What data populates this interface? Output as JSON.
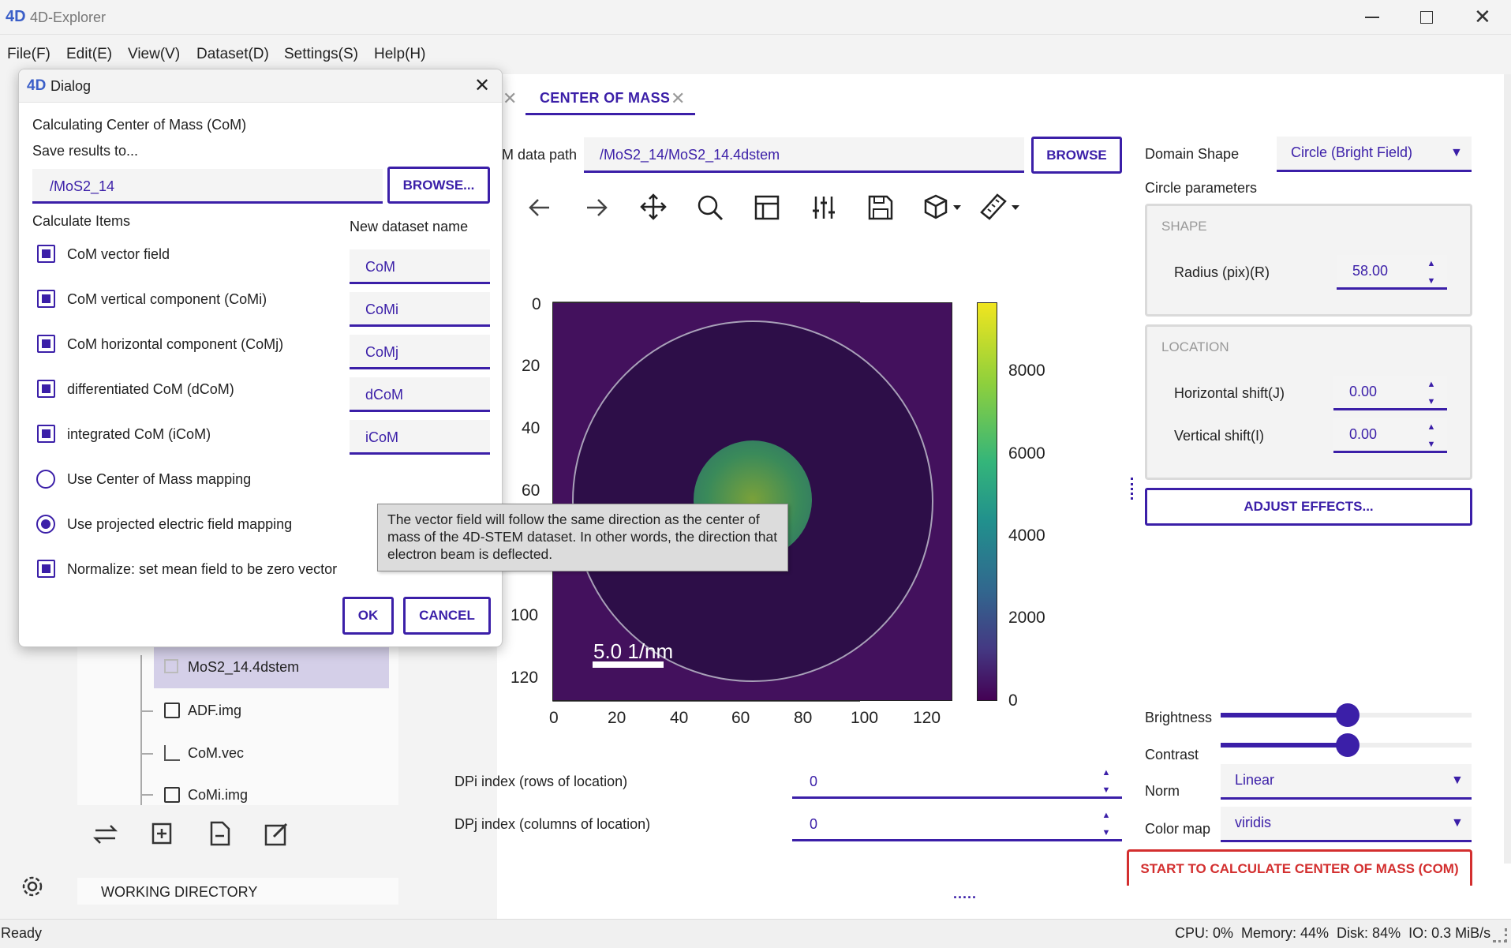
{
  "window": {
    "title": "4D-Explorer"
  },
  "menu": [
    "File(F)",
    "Edit(E)",
    "View(V)",
    "Dataset(D)",
    "Settings(S)",
    "Help(H)"
  ],
  "tabs": {
    "active": "CENTER OF MASS"
  },
  "data_path": {
    "label": "M data path",
    "value": "/MoS2_14/MoS2_14.4dstem",
    "browse": "BROWSE"
  },
  "domain": {
    "shape_label": "Domain Shape",
    "shape_value": "Circle (Bright Field)",
    "circle_params": "Circle parameters",
    "shape_group": "SHAPE",
    "radius_label": "Radius (pix)(R)",
    "radius_value": "58.00",
    "location_group": "LOCATION",
    "hshift_label": "Horizontal shift(J)",
    "hshift_value": "0.00",
    "vshift_label": "Vertical shift(I)",
    "vshift_value": "0.00",
    "adjust_effects": "ADJUST EFFECTS..."
  },
  "display": {
    "brightness_label": "Brightness",
    "brightness_level": 0.5,
    "contrast_label": "Contrast",
    "contrast_level": 0.5,
    "norm_label": "Norm",
    "norm_value": "Linear",
    "colormap_label": "Color map",
    "colormap_value": "viridis",
    "start_button": "START TO CALCULATE CENTER OF MASS (COM)"
  },
  "index": {
    "dpi_label": "DPi index (rows of location)",
    "dpi_value": "0",
    "dpj_label": "DPj index (columns of location)",
    "dpj_value": "0"
  },
  "plot": {
    "y_ticks": [
      "0",
      "20",
      "40",
      "60",
      "100",
      "120"
    ],
    "x_ticks": [
      "0",
      "20",
      "40",
      "60",
      "80",
      "100",
      "120"
    ],
    "colorbar_ticks": [
      "8000",
      "6000",
      "4000",
      "2000",
      "0"
    ],
    "scale_bar": "5.0 1/nm"
  },
  "file_tree": {
    "items": [
      "MoS2_14.4dstem",
      "ADF.img",
      "CoM.vec",
      "CoMi.img"
    ],
    "selected": "MoS2_14.4dstem",
    "working_dir": "WORKING DIRECTORY"
  },
  "dialog": {
    "title": "Dialog",
    "heading": "Calculating Center of Mass (CoM)",
    "save_to": "Save results to...",
    "path": "/MoS2_14",
    "browse": "BROWSE...",
    "calc_items": "Calculate Items",
    "new_name": "New dataset name",
    "items": [
      {
        "label": "CoM vector field",
        "name": "CoM",
        "checked": true
      },
      {
        "label": "CoM vertical component (CoMi)",
        "name": "CoMi",
        "checked": true
      },
      {
        "label": "CoM horizontal component (CoMj)",
        "name": "CoMj",
        "checked": true
      },
      {
        "label": "differentiated CoM (dCoM)",
        "name": "dCoM",
        "checked": true
      },
      {
        "label": "integrated CoM (iCoM)",
        "name": "iCoM",
        "checked": true
      }
    ],
    "radio1": "Use Center of Mass mapping",
    "radio2": "Use projected electric field mapping",
    "normalize": "Normalize: set mean field to be zero vector",
    "ok": "OK",
    "cancel": "CANCEL"
  },
  "tooltip": "The vector field will follow the same direction as the center of mass of the 4D-STEM dataset. In other words, the direction that electron beam is deflected.",
  "statusbar": {
    "left": "Ready",
    "right": "CPU: 0%  Memory: 44%  Disk: 84%  IO: 0.3 MiB/s"
  },
  "colors": {
    "accent": "#3b1fa8",
    "start": "#d32f2f"
  }
}
